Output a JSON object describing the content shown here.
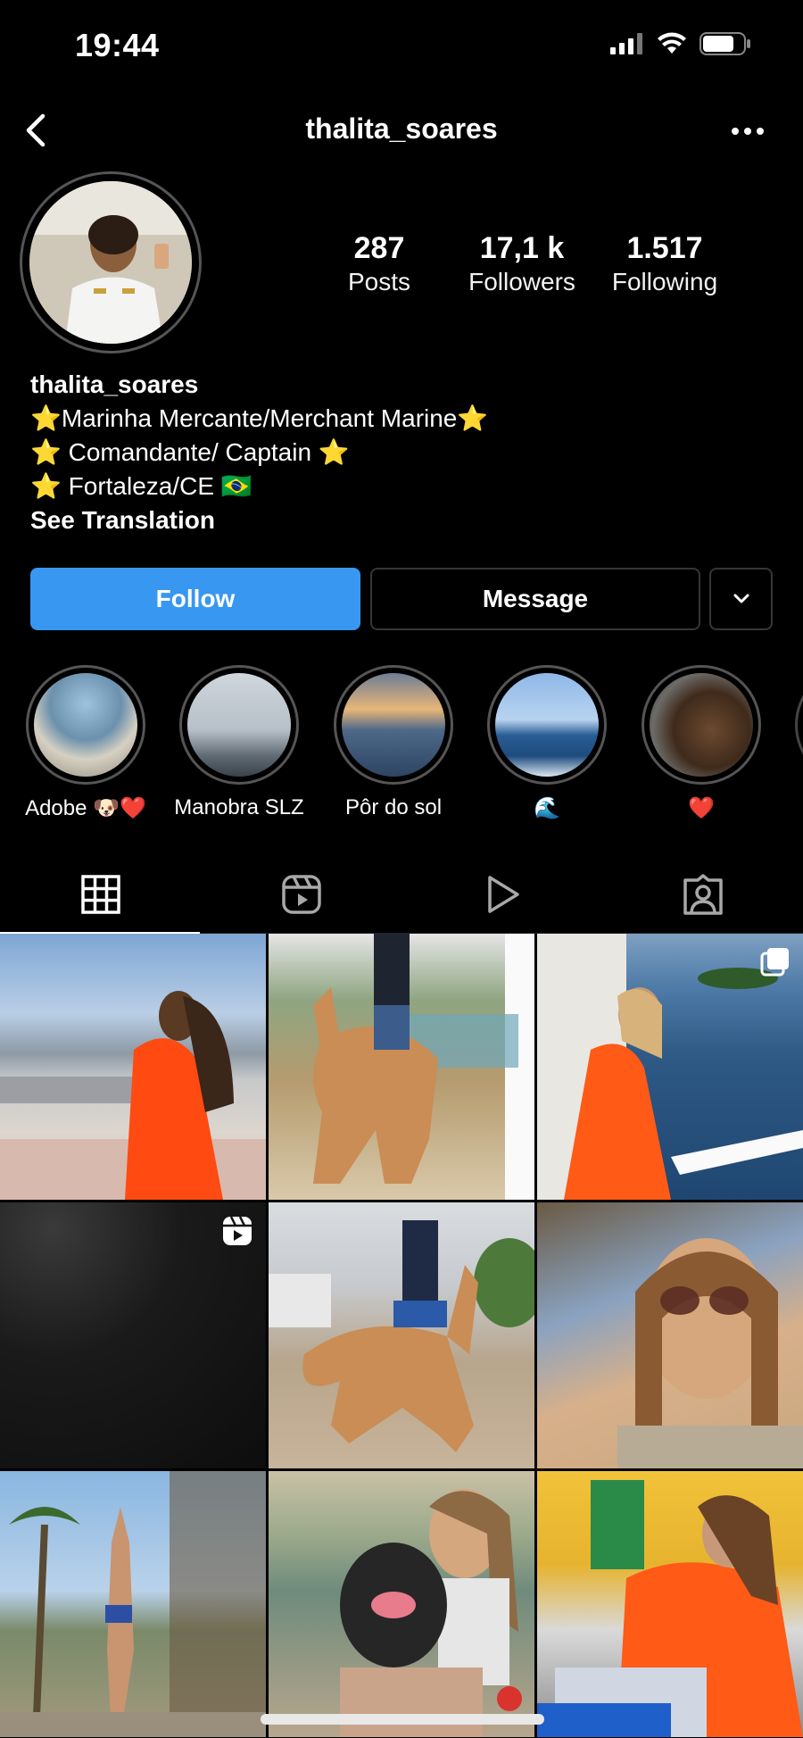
{
  "status_bar": {
    "time": "19:44"
  },
  "header": {
    "title": "thalita_soares"
  },
  "profile": {
    "stats": [
      {
        "value": "287",
        "label": "Posts"
      },
      {
        "value": "17,1 k",
        "label": "Followers"
      },
      {
        "value": "1.517",
        "label": "Following"
      }
    ],
    "name": "thalita_soares",
    "bio_lines": [
      "⭐️Marinha Mercante/Merchant Marine⭐️",
      "⭐️ Comandante/ Captain ⭐️",
      "⭐️ Fortaleza/CE 🇧🇷"
    ],
    "see_translation": "See Translation"
  },
  "actions": {
    "follow": "Follow",
    "message": "Message"
  },
  "highlights": [
    {
      "label": "Adobe 🐶❤️"
    },
    {
      "label": "Manobra SLZ"
    },
    {
      "label": "Pôr do sol"
    },
    {
      "label": "🌊"
    },
    {
      "label": "❤️"
    }
  ],
  "tabs": [
    "grid-icon",
    "reels-icon",
    "video-play-icon",
    "tagged-icon"
  ],
  "colors": {
    "accent": "#3897f0",
    "background": "#000000"
  },
  "grid_posts": [
    {
      "badge": ""
    },
    {
      "badge": ""
    },
    {
      "badge": "carousel-icon"
    },
    {
      "badge": "reels-icon"
    },
    {
      "badge": ""
    },
    {
      "badge": ""
    },
    {
      "badge": ""
    },
    {
      "badge": ""
    },
    {
      "badge": ""
    }
  ]
}
